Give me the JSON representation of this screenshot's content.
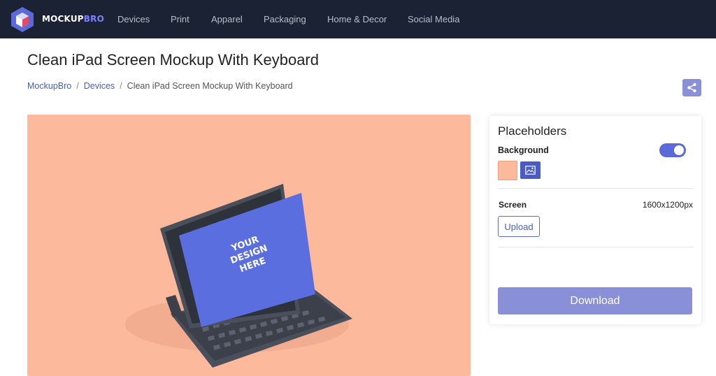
{
  "header": {
    "brand_main": "MOCKUP",
    "brand_accent": "BRO",
    "nav": [
      "Devices",
      "Print",
      "Apparel",
      "Packaging",
      "Home & Decor",
      "Social Media"
    ]
  },
  "page": {
    "title": "Clean iPad Screen Mockup With Keyboard",
    "breadcrumb": [
      "MockupBro",
      "Devices",
      "Clean iPad Screen Mockup With Keyboard"
    ]
  },
  "preview": {
    "screen_text": [
      "YOUR",
      "DESIGN",
      "HERE"
    ],
    "background_color": "#fdb99b",
    "screen_color": "#5b6ee0"
  },
  "panel": {
    "title": "Placeholders",
    "background_label": "Background",
    "background_enabled": true,
    "screen_label": "Screen",
    "screen_resolution": "1600x1200px",
    "upload_label": "Upload",
    "download_label": "Download"
  },
  "colors": {
    "header_bg": "#1b2233",
    "accent": "#5b6ad8",
    "button_muted": "#8a90d8"
  },
  "icons": {
    "logo": "mockupbro-cube-logo",
    "share": "share-icon",
    "image": "image-icon"
  }
}
